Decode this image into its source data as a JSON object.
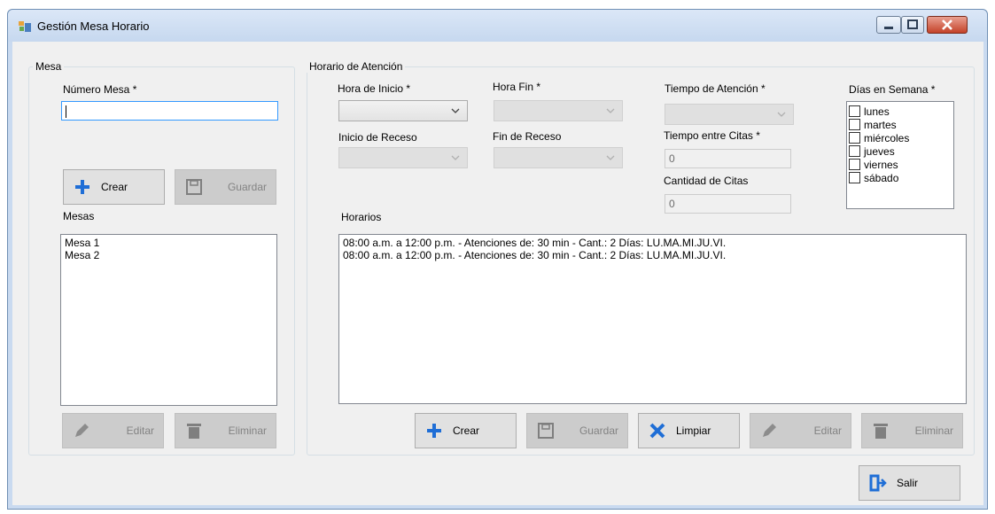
{
  "window": {
    "title": "Gestión Mesa Horario",
    "accent": "#c9daf0",
    "close_color": "#c44229"
  },
  "mesa_group": {
    "legend": "Mesa",
    "numero_label": "Número Mesa *",
    "numero_value": "",
    "crear_label": "Crear",
    "guardar_label": "Guardar",
    "mesas_label": "Mesas",
    "mesas_items": [
      "Mesa 1",
      "Mesa 2"
    ],
    "editar_label": "Editar",
    "eliminar_label": "Eliminar"
  },
  "horario_group": {
    "legend": "Horario de Atención",
    "hora_inicio_label": "Hora de Inicio *",
    "hora_fin_label": "Hora Fin *",
    "inicio_receso_label": "Inicio de Receso",
    "fin_receso_label": "Fin de Receso",
    "tiempo_atencion_label": "Tiempo de Atención *",
    "tiempo_entre_citas_label": "Tiempo entre Citas *",
    "tiempo_entre_citas_value": "0",
    "cantidad_citas_label": "Cantidad de Citas",
    "cantidad_citas_value": "0",
    "dias_label": "Días en Semana *",
    "dias": [
      "lunes",
      "martes",
      "miércoles",
      "jueves",
      "viernes",
      "sábado"
    ],
    "horarios_label": "Horarios",
    "horarios_items": [
      "08:00 a.m. a 12:00 p.m. - Atenciones de: 30 min - Cant.: 2 Días: LU.MA.MI.JU.VI.",
      "08:00 a.m. a 12:00 p.m. - Atenciones de: 30 min - Cant.: 2 Días: LU.MA.MI.JU.VI."
    ],
    "crear_label": "Crear",
    "guardar_label": "Guardar",
    "limpiar_label": "Limpiar",
    "editar_label": "Editar",
    "eliminar_label": "Eliminar"
  },
  "salir_label": "Salir",
  "icons": {
    "app": "form-icon",
    "minimize": "minimize-icon",
    "maximize": "maximize-icon",
    "close": "close-icon",
    "plus": "plus-icon",
    "save": "floppy-icon",
    "edit": "pencil-icon",
    "delete": "trash-icon",
    "clear": "x-icon",
    "exit": "exit-door-icon"
  }
}
